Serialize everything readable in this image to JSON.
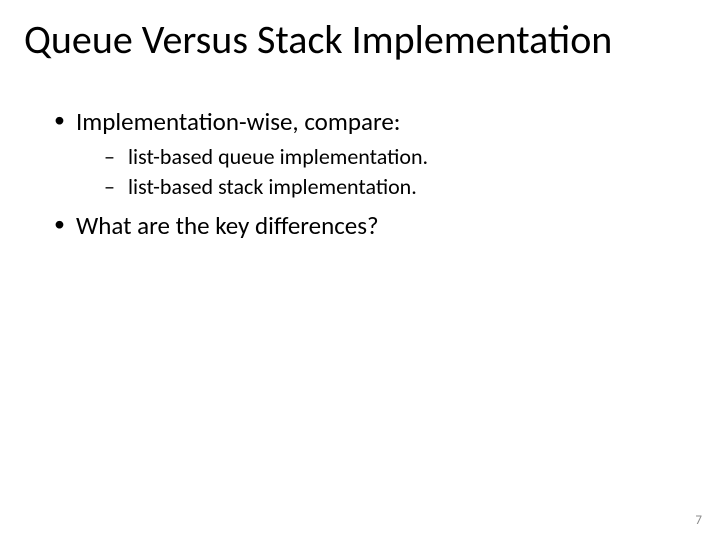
{
  "title": "Queue Versus Stack Implementation",
  "bullets": {
    "b1": "Implementation-wise, compare:",
    "b1_sub1": "list-based queue implementation.",
    "b1_sub2": "list-based stack implementation.",
    "b2": "What are the key differences?"
  },
  "page_number": "7"
}
